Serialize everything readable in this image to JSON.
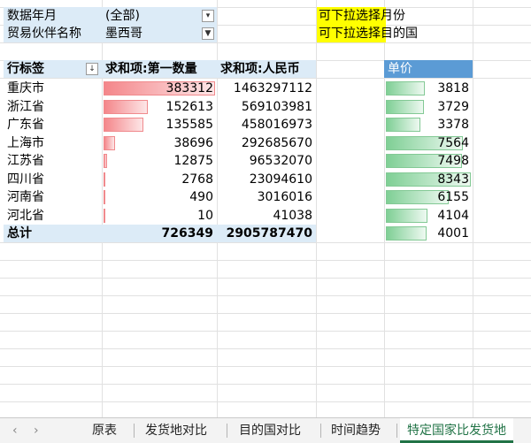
{
  "filters": [
    {
      "label": "数据年月",
      "value": "(全部)"
    },
    {
      "label": "贸易伙伴名称",
      "value": "墨西哥"
    }
  ],
  "notes": {
    "note1": "可下拉选择月份",
    "note2": "可下拉选择目的国"
  },
  "pivot": {
    "headers": {
      "row_label": "行标签",
      "qty": "求和项:第一数量",
      "rmb": "求和项:人民币",
      "price": "单价"
    },
    "rows": [
      {
        "name": "重庆市",
        "qty": "383312",
        "rmb": "1463297112",
        "price": "3818",
        "qty_v": 383312,
        "price_v": 3818
      },
      {
        "name": "浙江省",
        "qty": "152613",
        "rmb": "569103981",
        "price": "3729",
        "qty_v": 152613,
        "price_v": 3729
      },
      {
        "name": "广东省",
        "qty": "135585",
        "rmb": "458016973",
        "price": "3378",
        "qty_v": 135585,
        "price_v": 3378
      },
      {
        "name": "上海市",
        "qty": "38696",
        "rmb": "292685670",
        "price": "7564",
        "qty_v": 38696,
        "price_v": 7564
      },
      {
        "name": "江苏省",
        "qty": "12875",
        "rmb": "96532070",
        "price": "7498",
        "qty_v": 12875,
        "price_v": 7498
      },
      {
        "name": "四川省",
        "qty": "2768",
        "rmb": "23094610",
        "price": "8343",
        "qty_v": 2768,
        "price_v": 8343
      },
      {
        "name": "河南省",
        "qty": "490",
        "rmb": "3016016",
        "price": "6155",
        "qty_v": 490,
        "price_v": 6155
      },
      {
        "name": "河北省",
        "qty": "10",
        "rmb": "41038",
        "price": "4104",
        "qty_v": 10,
        "price_v": 4104
      }
    ],
    "total": {
      "label": "总计",
      "qty": "726349",
      "rmb": "2905787470",
      "price": "4001",
      "price_v": 4001
    }
  },
  "tabs": {
    "items": [
      "原表",
      "发货地对比",
      "目的国对比",
      "时间趋势",
      "特定国家比发货地"
    ],
    "active_index": 4
  },
  "colors": {
    "header_blue": "#dcebf7",
    "price_header": "#5b9bd5",
    "note_yellow": "#ffff00",
    "accent": "#217346"
  }
}
